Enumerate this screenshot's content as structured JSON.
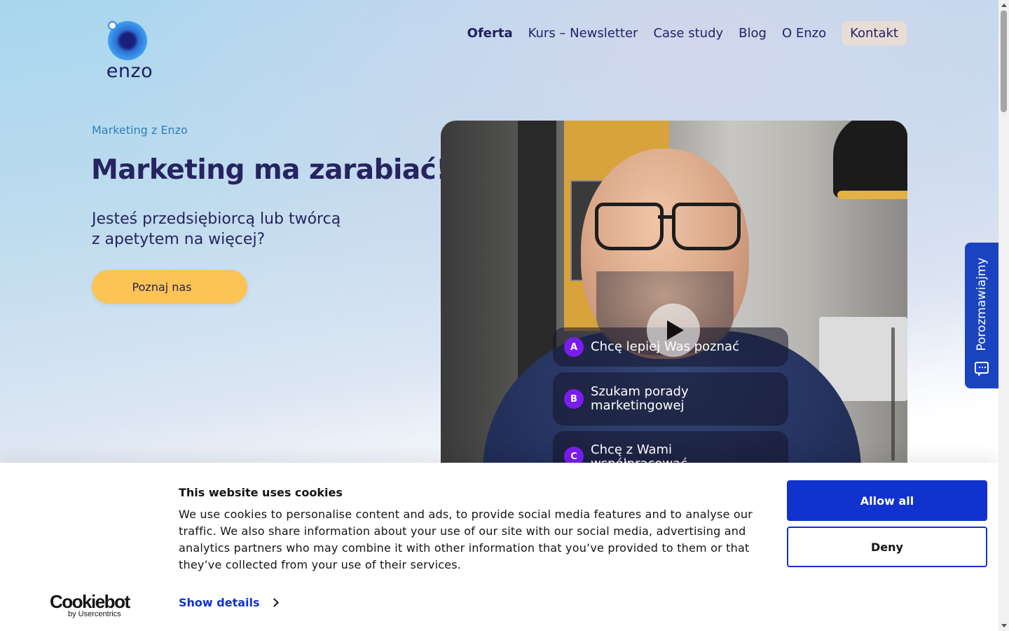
{
  "brand": {
    "logo_text": "enzo"
  },
  "nav": {
    "items": [
      {
        "label": "Oferta"
      },
      {
        "label": "Kurs – Newsletter"
      },
      {
        "label": "Case study"
      },
      {
        "label": "Blog"
      },
      {
        "label": "O Enzo"
      }
    ],
    "contact_label": "Kontakt"
  },
  "hero": {
    "eyebrow": "Marketing z Enzo",
    "title": "Marketing ma zarabiać!",
    "subtitle_line1": "Jesteś przedsiębiorcą lub twórcą",
    "subtitle_line2": "z apetytem na więcej?",
    "cta_label": "Poznaj nas"
  },
  "video": {
    "options": [
      {
        "letter": "A",
        "text": "Chcę lepiej Was poznać"
      },
      {
        "letter": "B",
        "text": "Szukam porady marketingowej"
      },
      {
        "letter": "C",
        "text": "Chcę z Wami współpracować"
      }
    ]
  },
  "side_tab": {
    "label": "Porozmawiajmy"
  },
  "cookie": {
    "title": "This website uses cookies",
    "text": "We use cookies to personalise content and ads, to provide social media features and to analyse our traffic. We also share information about your use of our site with our social media, advertising and analytics partners who may combine it with other information that you’ve provided to them or that they’ve collected from your use of their services.",
    "details_label": "Show details",
    "allow_label": "Allow all",
    "deny_label": "Deny",
    "logo_main": "Cookiebot",
    "logo_sub": "by Usercentrics"
  },
  "colors": {
    "brand_navy": "#262460",
    "cta_yellow": "#fcc356",
    "cookie_blue": "#1032cf",
    "option_purple": "#7a1cf0"
  }
}
